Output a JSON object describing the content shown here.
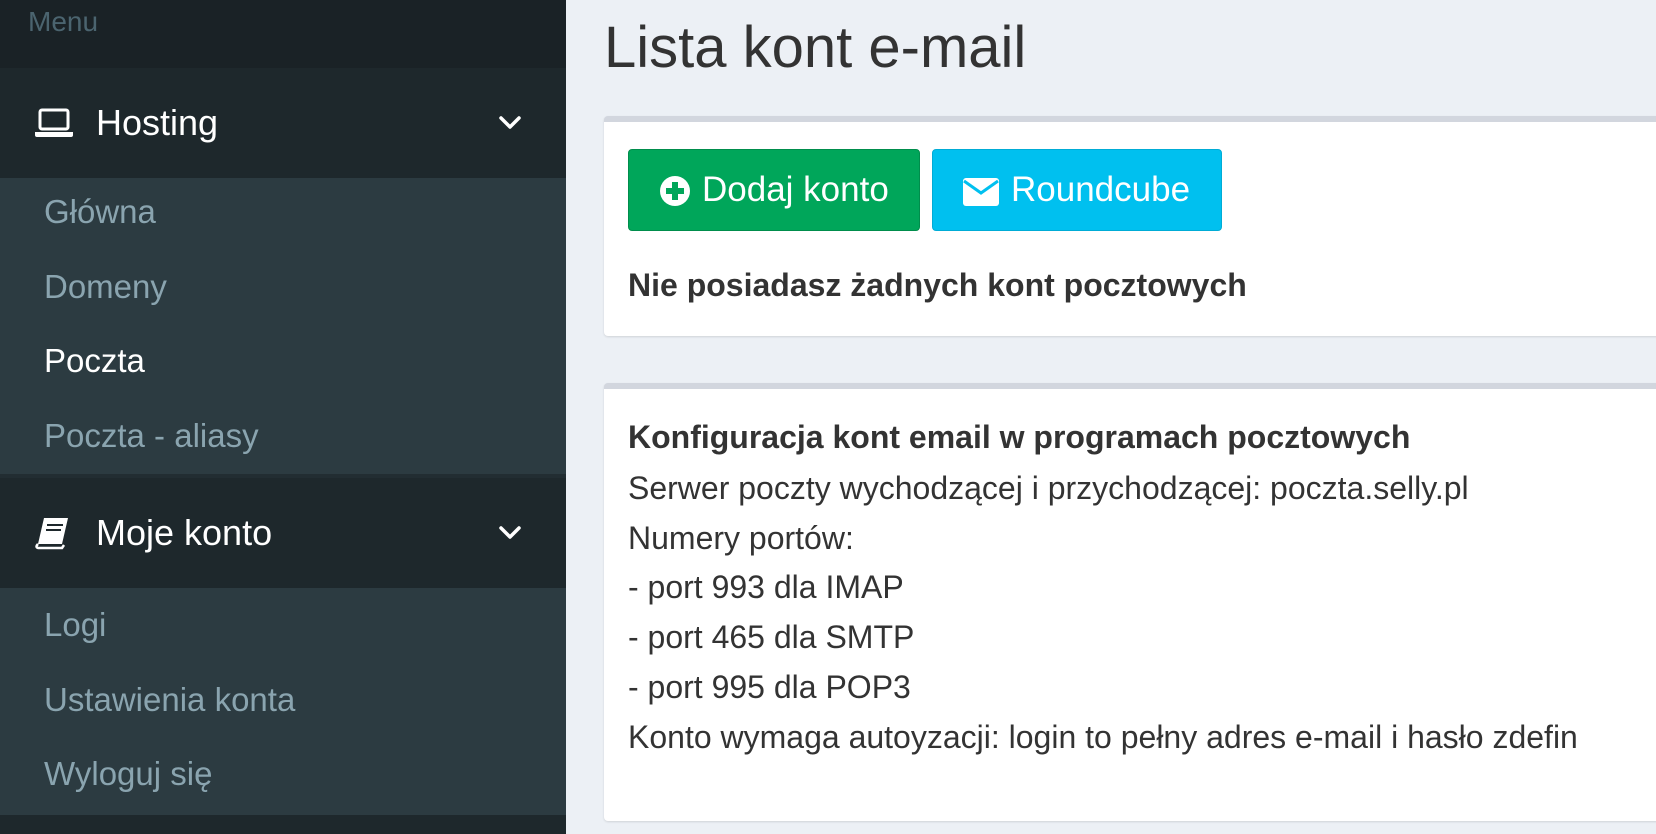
{
  "sidebar": {
    "menu_header": "Menu",
    "sections": [
      {
        "label": "Hosting",
        "icon": "laptop-icon",
        "items": [
          {
            "label": "Główna",
            "active": false
          },
          {
            "label": "Domeny",
            "active": false
          },
          {
            "label": "Poczta",
            "active": true
          },
          {
            "label": "Poczta - aliasy",
            "active": false
          }
        ]
      },
      {
        "label": "Moje konto",
        "icon": "book-icon",
        "items": [
          {
            "label": "Logi",
            "active": false
          },
          {
            "label": "Ustawienia konta",
            "active": false
          },
          {
            "label": "Wyloguj się",
            "active": false
          }
        ]
      }
    ]
  },
  "main": {
    "title": "Lista kont e-mail",
    "buttons": {
      "add_account": "Dodaj konto",
      "roundcube": "Roundcube"
    },
    "no_accounts_message": "Nie posiadasz żadnych kont pocztowych",
    "config": {
      "title": "Konfiguracja kont email w programach pocztowych",
      "lines": [
        "Serwer poczty wychodzącej i przychodzącej: poczta.selly.pl",
        "Numery portów:",
        "- port 993 dla IMAP",
        "- port 465 dla SMTP",
        "- port 995 dla POP3",
        "Konto wymaga autoyzacji: login to pełny adres e-mail i hasło zdefin"
      ]
    }
  },
  "colors": {
    "sidebar_bg": "#222d32",
    "sidebar_section_bg": "#1e282c",
    "submenu_bg": "#2c3b41",
    "main_bg": "#ecf0f5",
    "btn_success": "#00a65a",
    "btn_info": "#00c0ef"
  }
}
